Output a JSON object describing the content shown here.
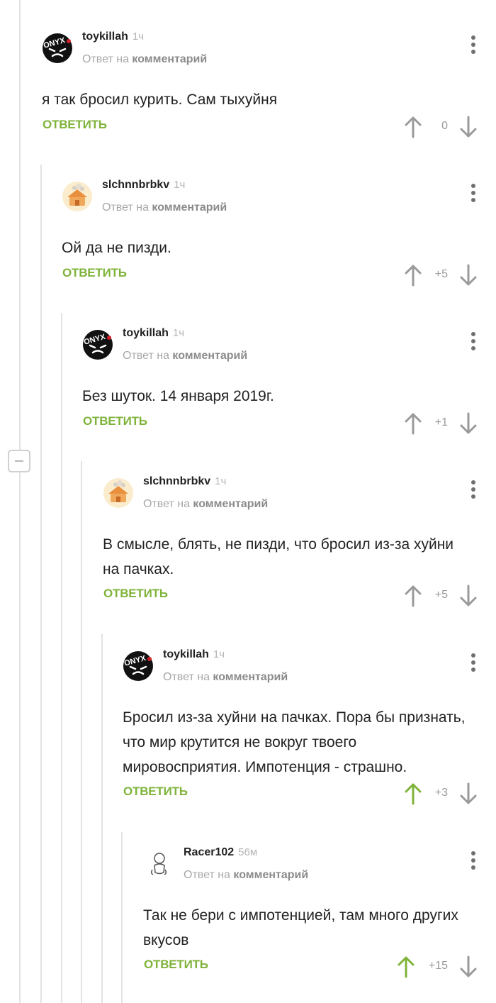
{
  "reply_to_prefix": "Ответ на",
  "reply_to_target": "комментарий",
  "reply_button_label": "ОТВЕТИТЬ",
  "colors": {
    "accent_green": "#7fb33a",
    "vote_gray": "#9a9a9a",
    "thread_line": "#e3e3e3"
  },
  "collapse_icon": "minus-icon",
  "comments": [
    {
      "author": "toykillah",
      "time": "1ч",
      "avatar": "onyx-black-face",
      "text": "я так бросил курить. Сам тыхуйня",
      "score": "0",
      "upvoted": false
    },
    {
      "author": "slchnnbrbkv",
      "time": "1ч",
      "avatar": "orange-house",
      "text": "Ой да не пизди.",
      "score": "+5",
      "upvoted": false
    },
    {
      "author": "toykillah",
      "time": "1ч",
      "avatar": "onyx-black-face",
      "text": "Без шуток. 14 января 2019г.",
      "score": "+1",
      "upvoted": false
    },
    {
      "author": "slchnnbrbkv",
      "time": "1ч",
      "avatar": "orange-house",
      "text": "В смысле, блять, не пизди, что бросил из-за хуйни на пачках.",
      "score": "+5",
      "upvoted": false
    },
    {
      "author": "toykillah",
      "time": "1ч",
      "avatar": "onyx-black-face",
      "text": "Бросил из-за хуйни на пачках. Пора бы признать, что мир крутится не вокруг твоего мировосприятия. Импотенция - страшно.",
      "score": "+3",
      "upvoted": true
    },
    {
      "author": "Racer102",
      "time": "56м",
      "avatar": "sketch-figure",
      "text": "Так не бери с импотенцией, там много других вкусов",
      "score": "+15",
      "upvoted": true
    }
  ]
}
